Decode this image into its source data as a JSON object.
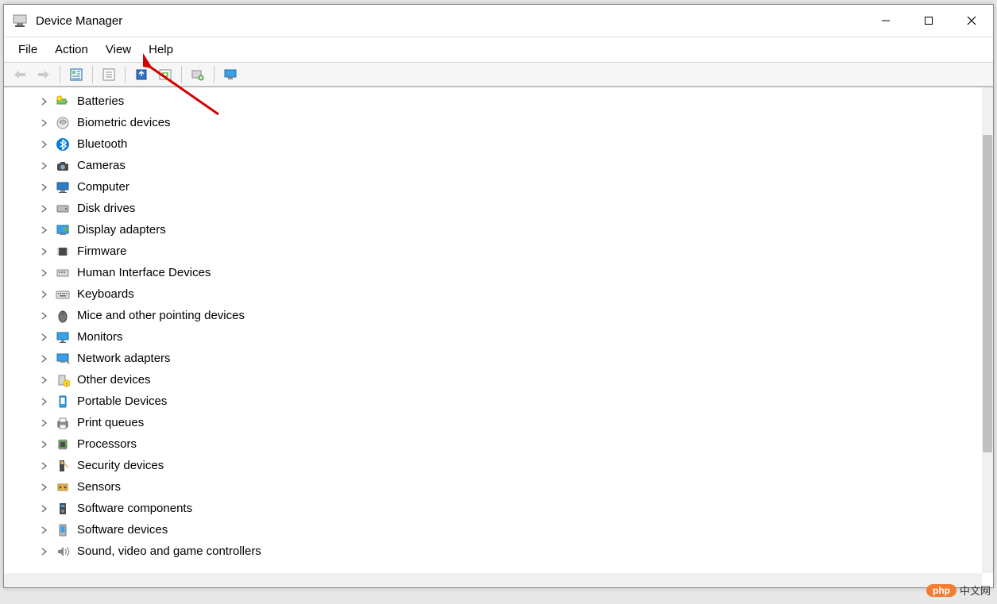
{
  "titlebar": {
    "title": "Device Manager"
  },
  "menubar": {
    "items": [
      {
        "label": "File"
      },
      {
        "label": "Action"
      },
      {
        "label": "View"
      },
      {
        "label": "Help"
      }
    ]
  },
  "toolbar": {
    "back": "back-icon",
    "forward": "forward-icon",
    "show_hidden": "show-hidden-icon",
    "properties": "properties-icon",
    "update_driver": "update-driver-icon",
    "uninstall": "uninstall-icon",
    "scan": "scan-hardware-icon",
    "add_legacy": "monitor-icon"
  },
  "tree": {
    "items": [
      {
        "label": "Batteries",
        "icon": "battery-icon"
      },
      {
        "label": "Biometric devices",
        "icon": "fingerprint-icon"
      },
      {
        "label": "Bluetooth",
        "icon": "bluetooth-icon"
      },
      {
        "label": "Cameras",
        "icon": "camera-icon"
      },
      {
        "label": "Computer",
        "icon": "computer-icon"
      },
      {
        "label": "Disk drives",
        "icon": "disk-icon"
      },
      {
        "label": "Display adapters",
        "icon": "display-adapter-icon"
      },
      {
        "label": "Firmware",
        "icon": "chip-icon"
      },
      {
        "label": "Human Interface Devices",
        "icon": "hid-icon"
      },
      {
        "label": "Keyboards",
        "icon": "keyboard-icon"
      },
      {
        "label": "Mice and other pointing devices",
        "icon": "mouse-icon"
      },
      {
        "label": "Monitors",
        "icon": "monitor-icon"
      },
      {
        "label": "Network adapters",
        "icon": "network-icon"
      },
      {
        "label": "Other devices",
        "icon": "other-devices-icon"
      },
      {
        "label": "Portable Devices",
        "icon": "portable-icon"
      },
      {
        "label": "Print queues",
        "icon": "printer-icon"
      },
      {
        "label": "Processors",
        "icon": "processor-icon"
      },
      {
        "label": "Security devices",
        "icon": "security-icon"
      },
      {
        "label": "Sensors",
        "icon": "sensor-icon"
      },
      {
        "label": "Software components",
        "icon": "software-component-icon"
      },
      {
        "label": "Software devices",
        "icon": "software-device-icon"
      },
      {
        "label": "Sound, video and game controllers",
        "icon": "sound-icon"
      }
    ]
  },
  "watermark": {
    "badge": "php",
    "text": "中文网"
  }
}
